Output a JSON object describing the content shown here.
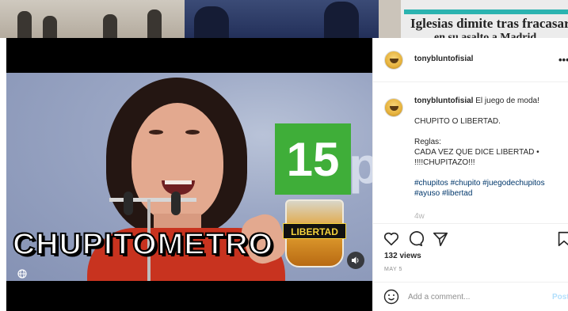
{
  "background": {
    "headline_line1": "Iglesias dimite tras fracasar",
    "headline_line2": "en su asalto a Madrid"
  },
  "media": {
    "overlay_title": "CHUPITOMETRO",
    "counter_value": "15",
    "glass_label": "LIBERTAD",
    "stage_letter": "p",
    "globe_icon": "globe-icon",
    "mute_icon": "speaker-muted-icon"
  },
  "panel": {
    "header": {
      "username": "tonybluntofisial",
      "more_label": "•••"
    },
    "caption": {
      "username": "tonybluntofisial",
      "lines": [
        "El juego de moda!",
        "CHUPITO O LIBERTAD.",
        "Reglas:",
        "CADA VEZ QUE DICE LIBERTAD •",
        "!!!!CHUPITAZO!!!",
        "#chupitos #chupito #juegodechupitos",
        "#ayuso #libertad"
      ],
      "faded_text": "4w"
    },
    "actions": {
      "icons": [
        "heart-icon",
        "comment-icon",
        "share-icon",
        "bookmark-icon"
      ]
    },
    "views_text": "132 views",
    "date_text": "MAY 5",
    "comment": {
      "placeholder": "Add a comment...",
      "post_label": "Post"
    }
  },
  "colors": {
    "counter_bg": "#3fae39",
    "link": "#00376b",
    "post_disabled": "#b2dffc"
  }
}
